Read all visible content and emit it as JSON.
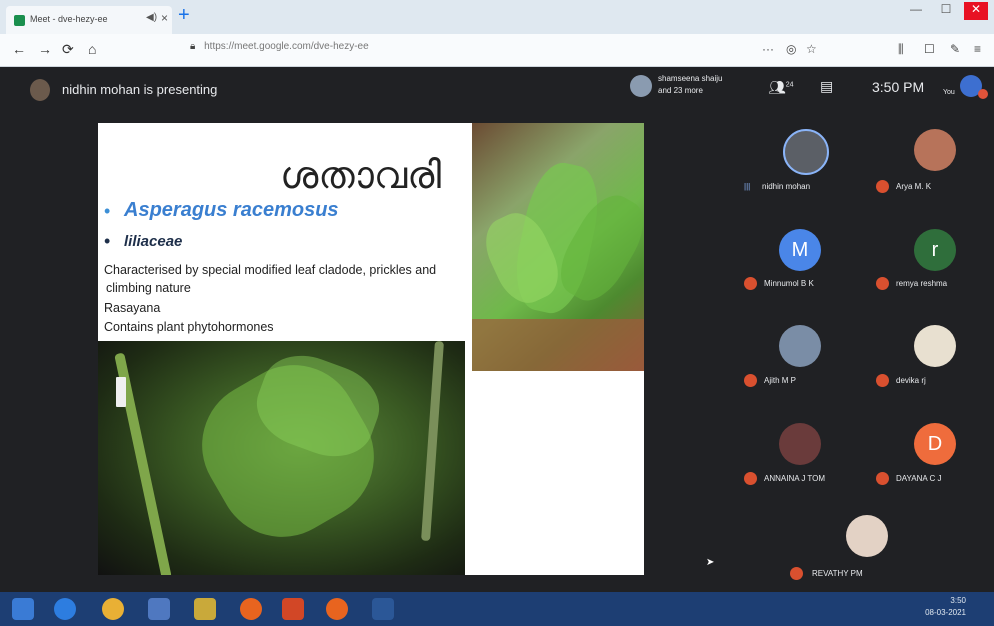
{
  "browser": {
    "tab_title": "Meet - dve-hezy-ee",
    "url_display": "https://meet.google.com/dve-hezy-ee",
    "url_domain": "google.com"
  },
  "meet": {
    "presenter_text": "nidhin mohan is presenting",
    "participants_line1": "shamseena shaiju",
    "participants_line2": "and 23 more",
    "people_count": "24",
    "clock": "3:50 PM",
    "you_label": "You"
  },
  "slide": {
    "title": "ശതാവരി",
    "species": "Asperagus racemosus",
    "family": "liliaceae",
    "lines": [
      "Characterised by special modified leaf cladode, prickles and",
      "climbing nature",
      "Rasayana",
      "Contains plant phytohormones"
    ]
  },
  "participants": [
    {
      "name": "nidhin mohan",
      "initial": "",
      "color": "#5b5f66"
    },
    {
      "name": "Arya M. K",
      "initial": "",
      "color": "#b7735a"
    },
    {
      "name": "Minnumol B K",
      "initial": "M",
      "color": "#4a86e8"
    },
    {
      "name": "remya reshma",
      "initial": "r",
      "color": "#2f6e3b"
    },
    {
      "name": "Ajith M P",
      "initial": "",
      "color": "#7a8da6"
    },
    {
      "name": "devika rj",
      "initial": "",
      "color": "#e8e0d0"
    },
    {
      "name": "ANNAINA J TOM",
      "initial": "",
      "color": "#6a3b3b"
    },
    {
      "name": "DAYANA C J",
      "initial": "D",
      "color": "#ef6c3c"
    },
    {
      "name": "REVATHY PM",
      "initial": "",
      "color": "#e3d2c5"
    }
  ],
  "taskbar": {
    "time": "3:50",
    "date": "08-03-2021"
  }
}
